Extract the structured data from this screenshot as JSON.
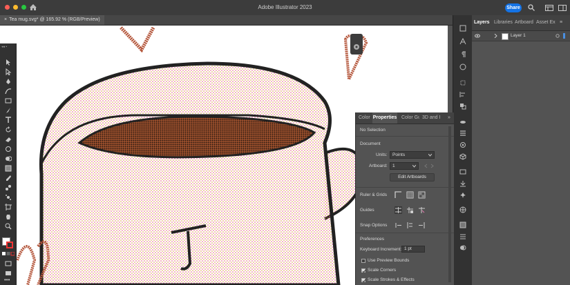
{
  "app": {
    "title": "Adobe Illustrator 2023",
    "share_label": "Share"
  },
  "document_tab": {
    "label": "Tea mug.svg* @ 165.92 % (RGB/Preview)",
    "close": "×"
  },
  "layers_panel": {
    "tabs": [
      "Layers",
      "Libraries",
      "Artboard",
      "Asset Ex"
    ],
    "layer_name": "Layer 1"
  },
  "properties_panel": {
    "tabs": [
      "Color",
      "Properties",
      "Color Gu",
      "3D and I"
    ],
    "more": "»",
    "selection": "No Selection",
    "document_heading": "Document",
    "units_label": "Units:",
    "units_value": "Points",
    "artboard_label": "Artboard:",
    "artboard_value": "1",
    "edit_artboards": "Edit Artboards",
    "ruler_grids": "Ruler & Grids",
    "guides": "Guides",
    "snap_options": "Snap Options",
    "preferences_heading": "Preferences",
    "keyboard_increment_label": "Keyboard Increment:",
    "keyboard_increment_value": "1 pt",
    "use_preview_bounds": "Use Preview Bounds",
    "scale_corners": "Scale Corners",
    "scale_strokes": "Scale Strokes & Effects"
  },
  "colors": {
    "accent": "#1473e6",
    "mug_stroke": "#222222",
    "coffee": "#8b4a2b",
    "close_red": "#ff5f57",
    "min_yellow": "#febc2e",
    "max_green": "#28c840"
  }
}
